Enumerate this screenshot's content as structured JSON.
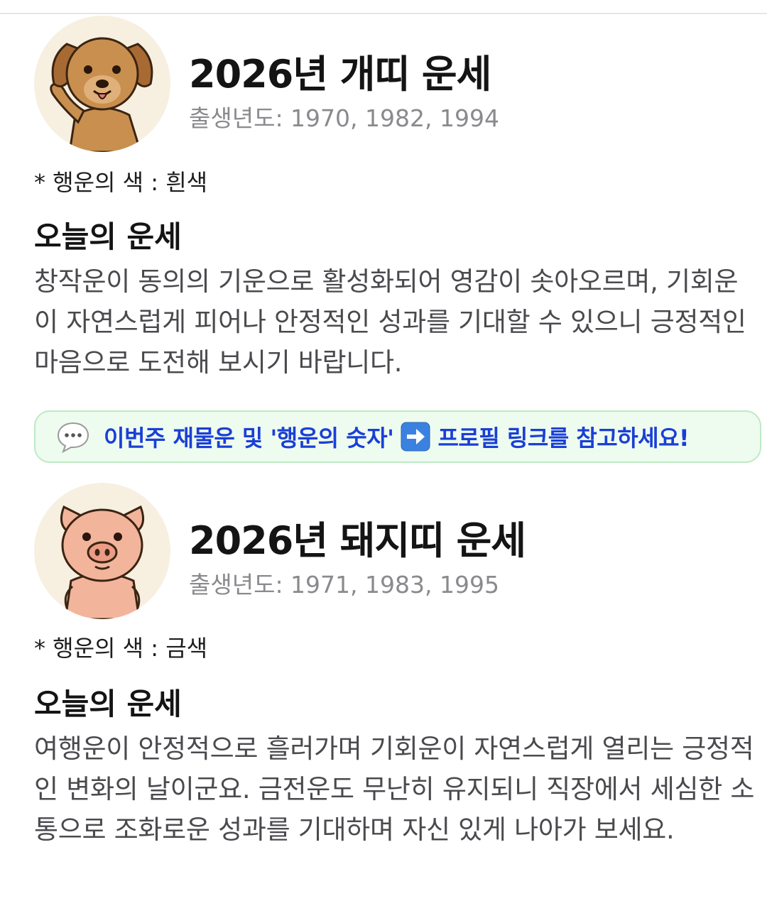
{
  "dog": {
    "title": "2026년 개띠 운세",
    "birth_years": "출생년도: 1970, 1982, 1994",
    "lucky_color": "* 행운의 색 : 흰색",
    "today_heading": "오늘의 운세",
    "fortune": "창작운이 동의의 기운으로 활성화되어 영감이 솟아오르며, 기회운이 자연스럽게 피어나 안정적인 성과를 기대할 수 있으니 긍정적인 마음으로 도전해 보시기 바랍니다."
  },
  "banner": {
    "icon": "speech-bubble-icon",
    "text_before": "이번주 재물운 및 '행운의 숫자'",
    "arrow_icon": "right-arrow-icon",
    "text_after": "프로필 링크를 참고하세요!",
    "color": "#1a3fd6",
    "background": "#eefbef"
  },
  "pig": {
    "title": "2026년 돼지띠 운세",
    "birth_years": "출생년도: 1971, 1983, 1995",
    "lucky_color": "* 행운의 색 : 금색",
    "today_heading": "오늘의 운세",
    "fortune": "여행운이 안정적으로 흘러가며 기회운이 자연스럽게 열리는 긍정적인 변화의 날이군요. 금전운도 무난히 유지되니 직장에서 세심한 소통으로 조화로운 성과를 기대하며 자신 있게 나아가 보세요."
  }
}
